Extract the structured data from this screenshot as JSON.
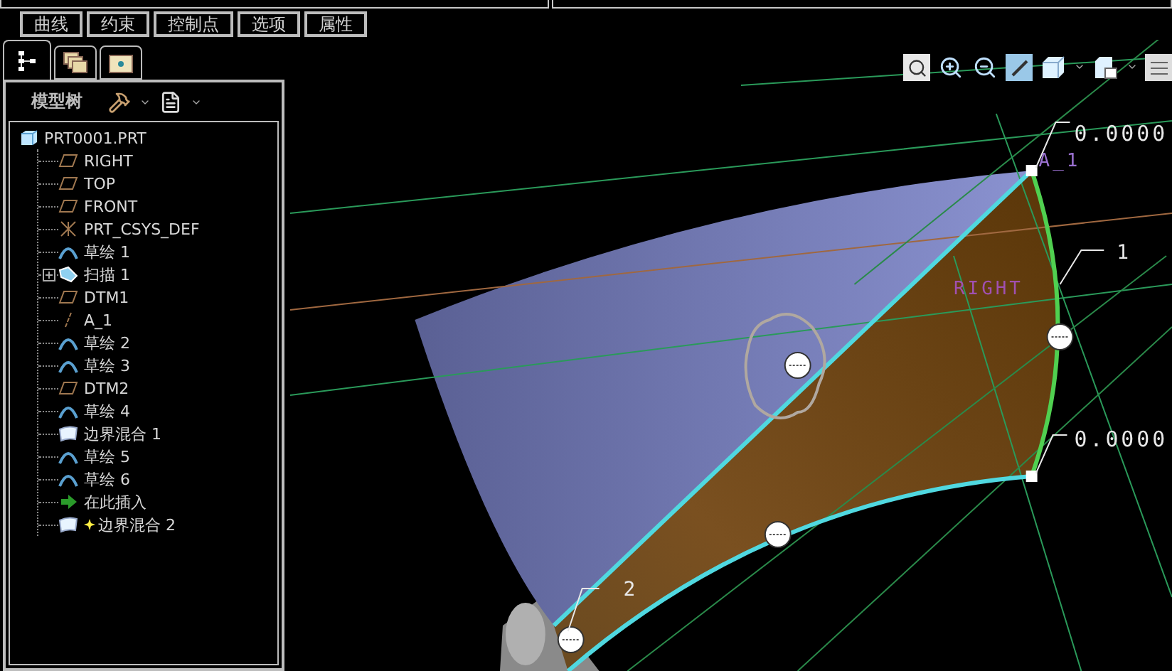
{
  "menu_tabs": [
    {
      "label": "曲线"
    },
    {
      "label": "约束"
    },
    {
      "label": "控制点"
    },
    {
      "label": "选项"
    },
    {
      "label": "属性"
    }
  ],
  "panel_tabs": [
    {
      "kind": "tree",
      "selected": true
    },
    {
      "kind": "layers",
      "selected": false
    },
    {
      "kind": "favorites",
      "selected": false
    }
  ],
  "model_tree": {
    "title": "模型树",
    "root": {
      "label": "PRT0001.PRT",
      "kind": "part",
      "children": [
        {
          "label": "RIGHT",
          "kind": "plane",
          "collapsed": false,
          "new": false
        },
        {
          "label": "TOP",
          "kind": "plane",
          "collapsed": false,
          "new": false
        },
        {
          "label": "FRONT",
          "kind": "plane",
          "collapsed": false,
          "new": false
        },
        {
          "label": "PRT_CSYS_DEF",
          "kind": "csys",
          "collapsed": false,
          "new": false
        },
        {
          "label": "草绘 1",
          "kind": "sketch",
          "collapsed": false,
          "new": false
        },
        {
          "label": "扫描 1",
          "kind": "sweep",
          "collapsed": true,
          "new": false
        },
        {
          "label": "DTM1",
          "kind": "plane",
          "collapsed": false,
          "new": false
        },
        {
          "label": "A_1",
          "kind": "axis",
          "collapsed": false,
          "new": false
        },
        {
          "label": "草绘 2",
          "kind": "sketch",
          "collapsed": false,
          "new": false
        },
        {
          "label": "草绘 3",
          "kind": "sketch",
          "collapsed": false,
          "new": false
        },
        {
          "label": "DTM2",
          "kind": "plane",
          "collapsed": false,
          "new": false
        },
        {
          "label": "草绘 4",
          "kind": "sketch",
          "collapsed": false,
          "new": false
        },
        {
          "label": "边界混合 1",
          "kind": "blend",
          "collapsed": false,
          "new": false
        },
        {
          "label": "草绘 5",
          "kind": "sketch",
          "collapsed": false,
          "new": false
        },
        {
          "label": "草绘 6",
          "kind": "sketch",
          "collapsed": false,
          "new": false
        },
        {
          "label": "在此插入",
          "kind": "insert",
          "collapsed": false,
          "new": false
        },
        {
          "label": "边界混合 2",
          "kind": "blend",
          "collapsed": false,
          "new": true
        }
      ]
    }
  },
  "viewport": {
    "labels": [
      {
        "text": "0.0000",
        "kind": "dimension"
      },
      {
        "text": "A_1",
        "kind": "datum"
      },
      {
        "text": "1",
        "kind": "dimension"
      },
      {
        "text": "RIGHT",
        "kind": "datum"
      },
      {
        "text": "0.0000",
        "kind": "dimension"
      },
      {
        "text": "2",
        "kind": "dimension"
      }
    ]
  }
}
